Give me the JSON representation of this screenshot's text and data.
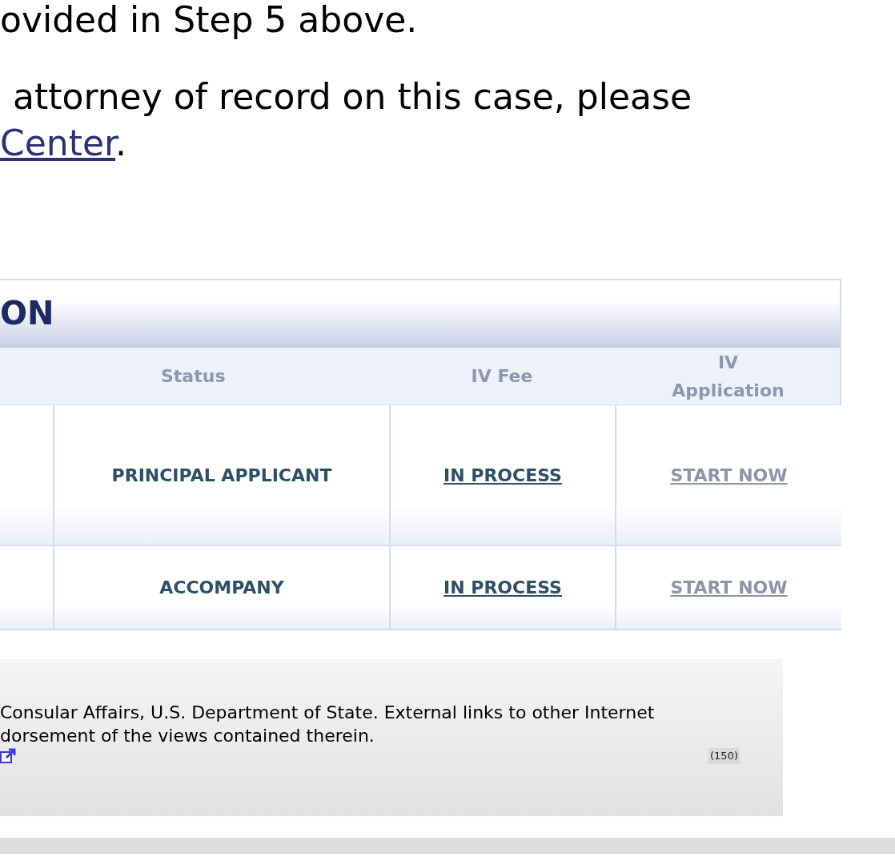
{
  "intro": {
    "line_1": "ovided in Step 5 above.",
    "line_2": "attorney of record on this case, please",
    "link": "Center",
    "end": "."
  },
  "table": {
    "title": "ON",
    "columns": [
      "Status",
      "IV Fee",
      "IV Application"
    ],
    "rows": [
      {
        "status": "PRINCIPAL APPLICANT",
        "iv_fee": {
          "label": "IN PROCESS",
          "disabled": false
        },
        "iv_application": {
          "label": "START NOW",
          "disabled": true
        }
      },
      {
        "status": "ACCOMPANY",
        "iv_fee": {
          "label": "IN PROCESS",
          "disabled": false
        },
        "iv_application": {
          "label": "START NOW",
          "disabled": true
        }
      }
    ]
  },
  "footer": {
    "line_1": "Consular Affairs, U.S. Department of State. External links to other Internet",
    "line_2": "dorsement of the views contained therein.",
    "counter": "(150)"
  }
}
